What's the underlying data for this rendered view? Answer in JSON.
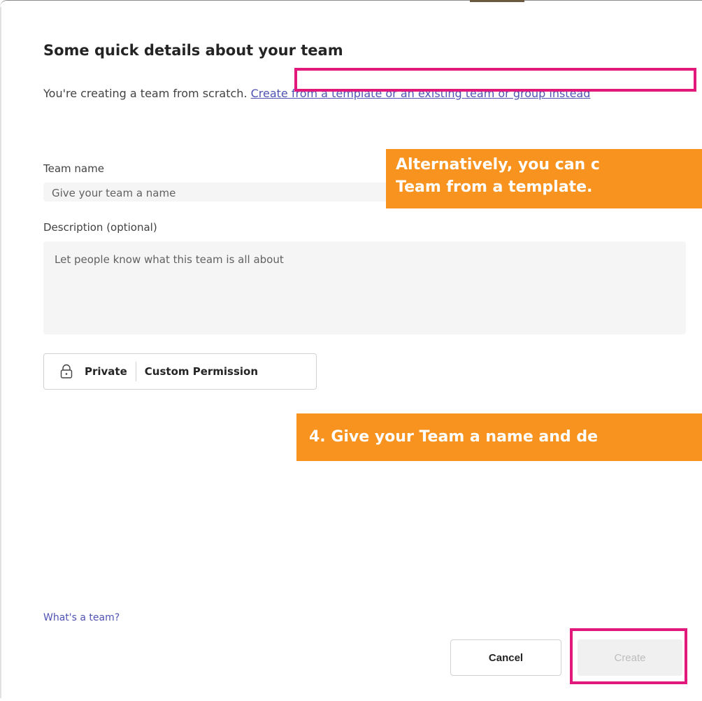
{
  "dialog": {
    "title": "Some quick details about your team",
    "intro_text": "You're creating a team from scratch. ",
    "template_link": "Create from a template or an existing team or group instead"
  },
  "form": {
    "team_name_label": "Team name",
    "team_name_placeholder": "Give your team a name",
    "description_label": "Description (optional)",
    "description_placeholder": "Let people know what this team is all about",
    "privacy_label": "Private",
    "permission_label": "Custom Permission"
  },
  "callouts": {
    "alternative_line1": "Alternatively, you can c",
    "alternative_line2": "Team from a template.",
    "step": "4. Give your Team a name and de"
  },
  "footer": {
    "help_link": "What's a team?",
    "cancel_label": "Cancel",
    "create_label": "Create"
  },
  "icons": {
    "lock": "lock-icon"
  },
  "colors": {
    "callout_bg": "#f7931e",
    "highlight_border": "#e3187c",
    "link": "#4f52b2"
  }
}
